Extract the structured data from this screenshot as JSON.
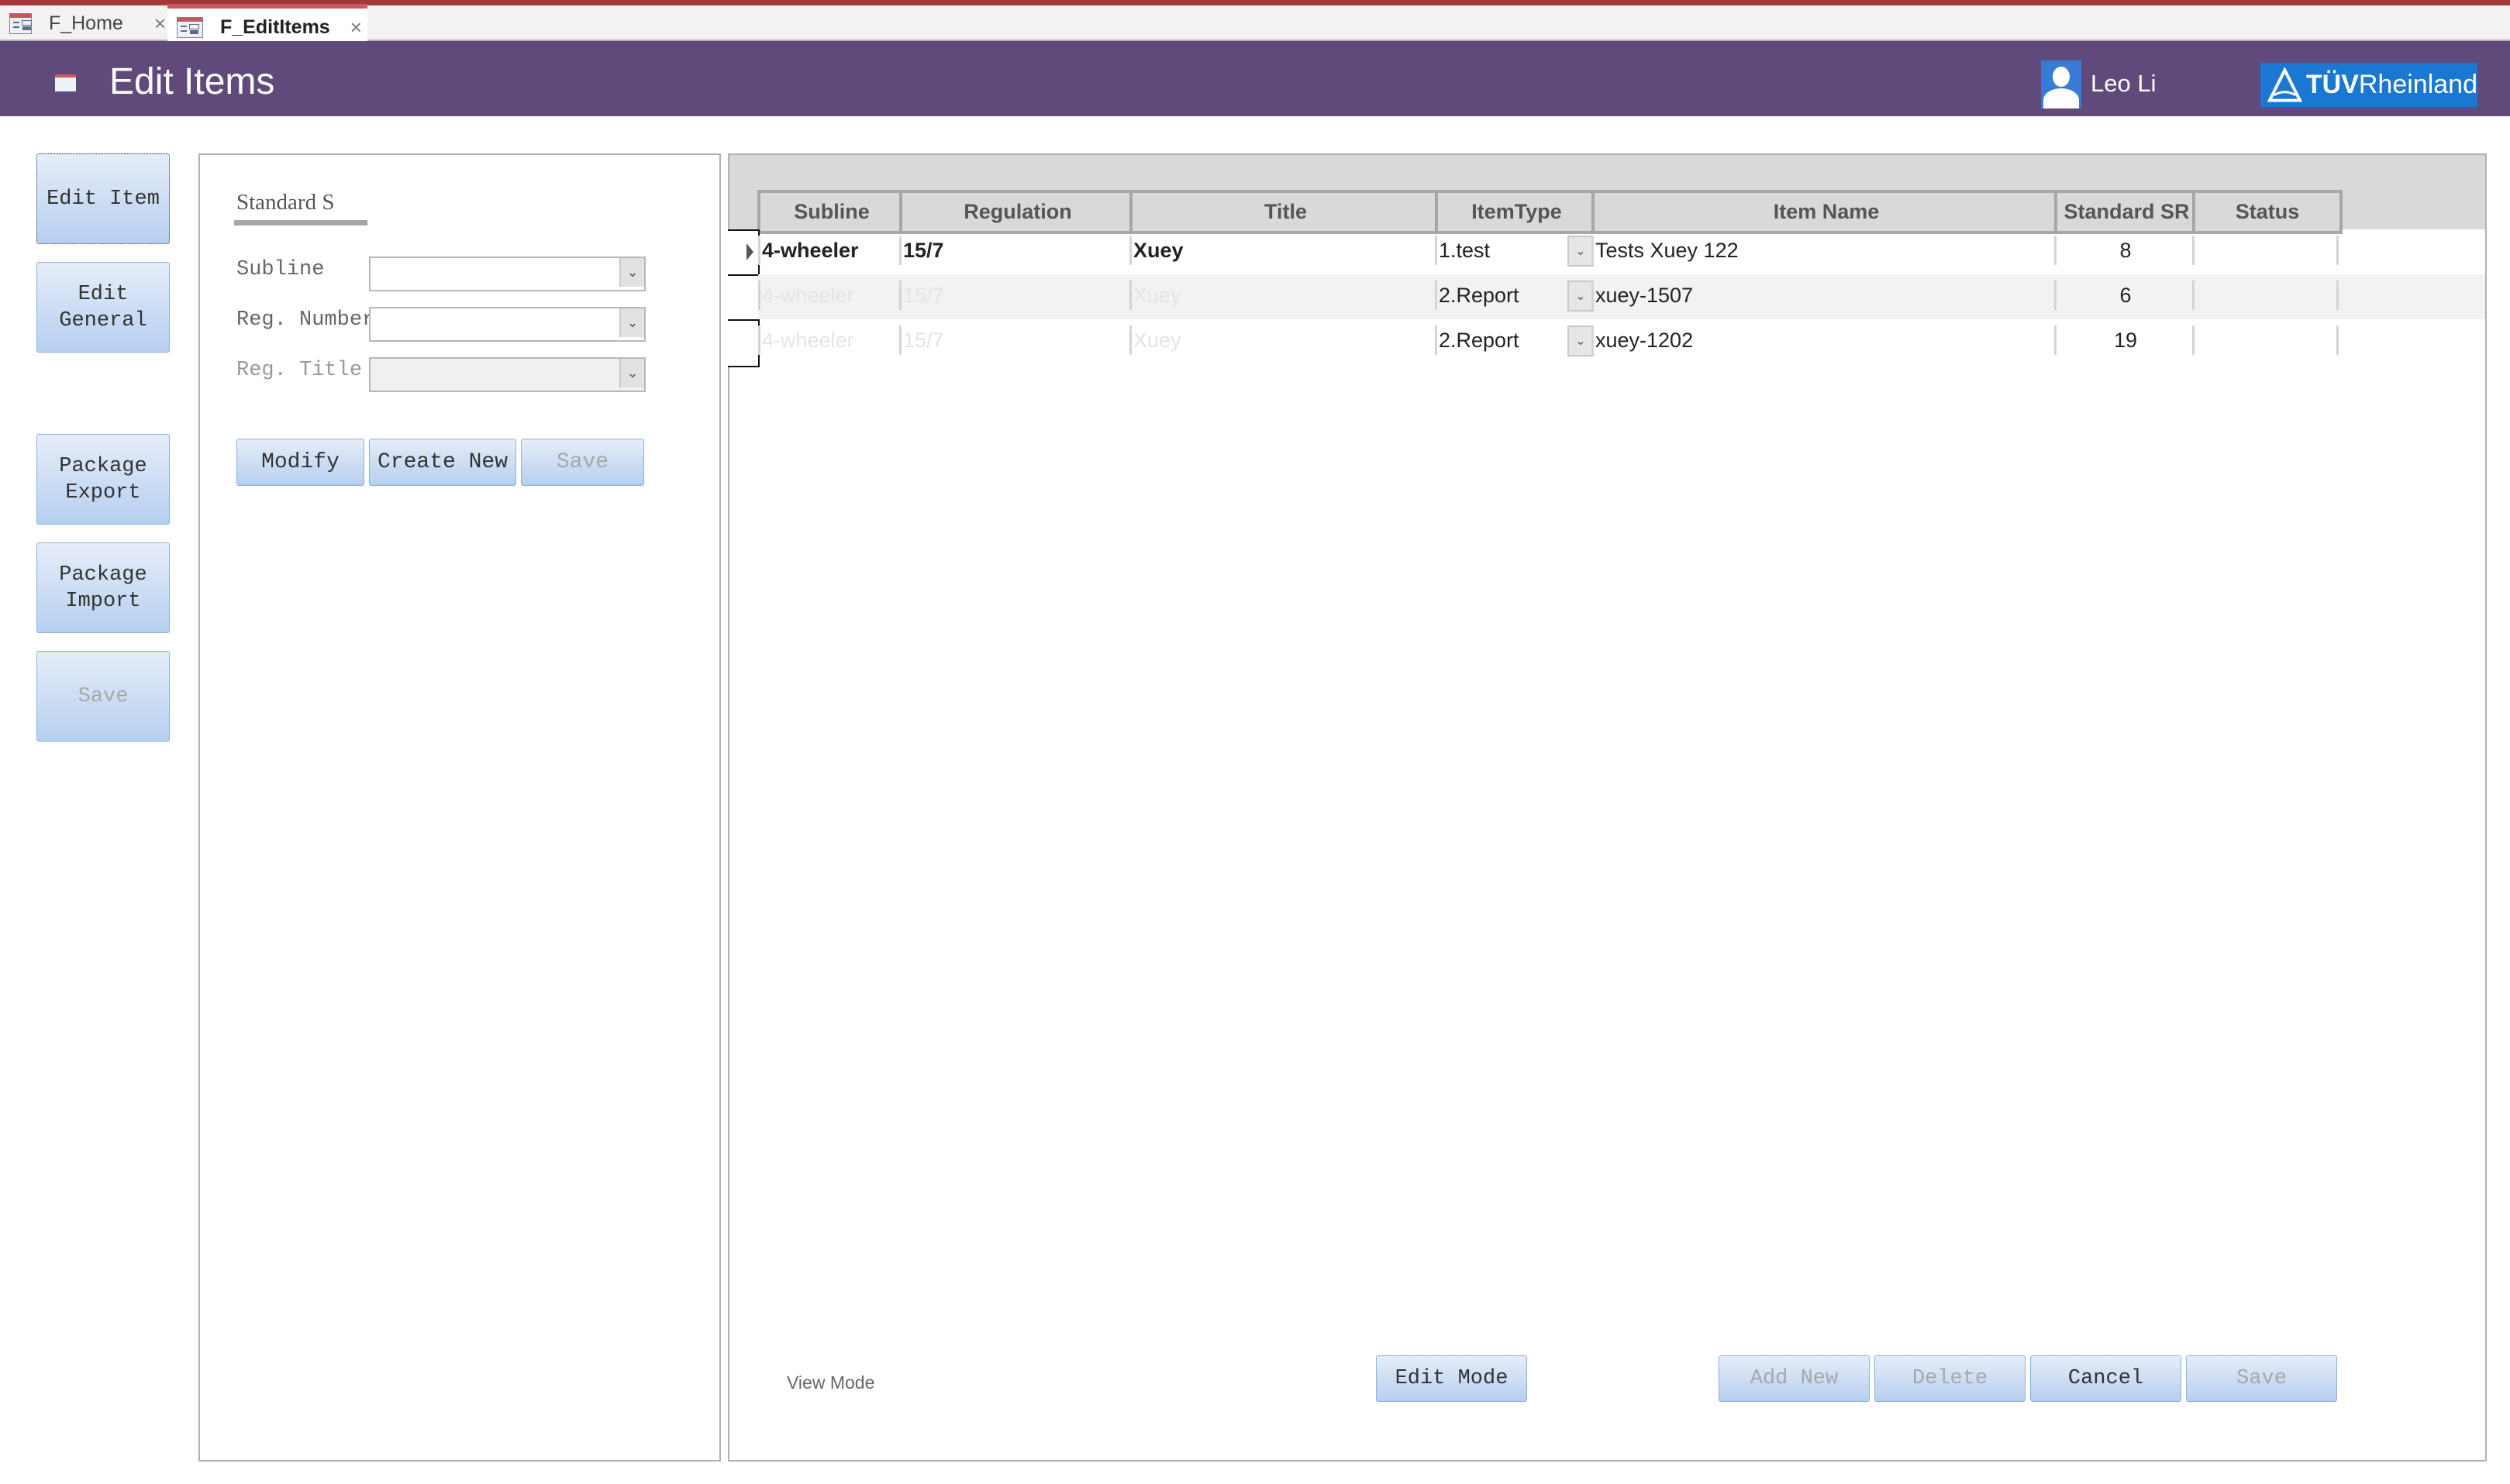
{
  "tabs": [
    {
      "label": "F_Home",
      "active": false,
      "close": "×"
    },
    {
      "label": "F_EditItems",
      "active": true,
      "close": "×"
    }
  ],
  "header": {
    "title": "Edit Items",
    "user_name": "Leo Li",
    "logo_bold": "TÜV",
    "logo_rest": "Rheinland",
    "colors": {
      "header_bg": "#604a7b",
      "logo_bg": "#1a78d2",
      "accent_bar": "#a4373a"
    }
  },
  "nav": {
    "edit_item": "Edit Item",
    "edit_general": "Edit\nGeneral",
    "package_export": "Package\nExport",
    "package_import": "Package\nImport",
    "save": "Save"
  },
  "form": {
    "section_label": "Standard S",
    "subline_label": "Subline",
    "subline_value": "",
    "reg_number_label": "Reg. Number",
    "reg_number_value": "",
    "reg_title_label": "Reg. Title",
    "reg_title_value": "",
    "dropdown_glyph": "⌄",
    "modify": "Modify",
    "create_new": "Create New",
    "save": "Save"
  },
  "table": {
    "columns": [
      "Subline",
      "Regulation",
      "Title",
      "ItemType",
      "Item Name",
      "Standard SR",
      "Status"
    ],
    "rows": [
      {
        "subline": "4-wheeler",
        "regulation": "15/7",
        "title": "Xuey",
        "item_type": "1.test",
        "item_name": "Tests Xuey 122",
        "standard_sr": "8",
        "status": "",
        "current": true
      },
      {
        "subline": "4-wheeler",
        "regulation": "15/7",
        "title": "Xuey",
        "item_type": "2.Report",
        "item_name": "xuey-1507",
        "standard_sr": "6",
        "status": "",
        "current": false
      },
      {
        "subline": "4-wheeler",
        "regulation": "15/7",
        "title": "Xuey",
        "item_type": "2.Report",
        "item_name": "xuey-1202",
        "standard_sr": "19",
        "status": "",
        "current": false
      }
    ]
  },
  "footer": {
    "mode_label": "View Mode",
    "edit_mode": "Edit Mode",
    "add_new": "Add New",
    "delete": "Delete",
    "cancel": "Cancel",
    "save": "Save"
  }
}
